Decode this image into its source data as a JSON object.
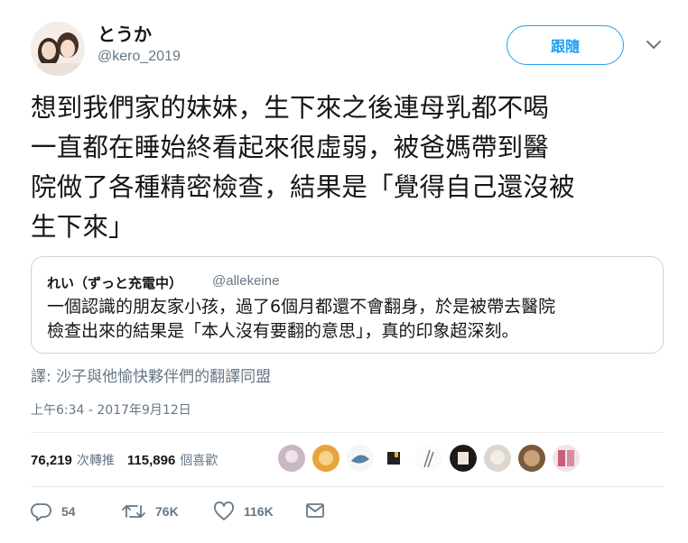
{
  "author": {
    "display_name": "とうか",
    "handle": "@kero_2019",
    "follow_label": "跟隨"
  },
  "tweet": {
    "text": "想到我們家的妹妹，生下來之後連母乳都不喝\n一直都在睡始終看起來很虛弱，被爸媽帶到醫\n院做了各種精密檢查，結果是「覺得自己還沒被\n生下來」"
  },
  "quoted_tweet": {
    "display_name": "れい（ずっと充電中）",
    "handle": "@allekeine",
    "text": "一個認識的朋友家小孩，過了6個月都還不會翻身，於是被帶去醫院\n檢查出來的結果是「本人沒有要翻的意思」，真的印象超深刻。"
  },
  "translated_by": "譯: 沙子與他愉快夥伴們的翻譯同盟",
  "timestamp": "上午6:34 - 2017年9月12日",
  "stats": {
    "retweets_count": "76,219",
    "retweets_label": "次轉推",
    "likes_count": "115,896",
    "likes_label": "個喜歡"
  },
  "actions": {
    "reply_count": "54",
    "retweet_count": "76K",
    "like_count": "116K"
  },
  "colors": {
    "accent": "#1da1f2",
    "text": "#14171a",
    "secondary_text": "#657786",
    "border": "#e6ecf0"
  },
  "icons": [
    "chevron-down-icon",
    "reply-icon",
    "retweet-icon",
    "like-icon",
    "message-icon"
  ]
}
